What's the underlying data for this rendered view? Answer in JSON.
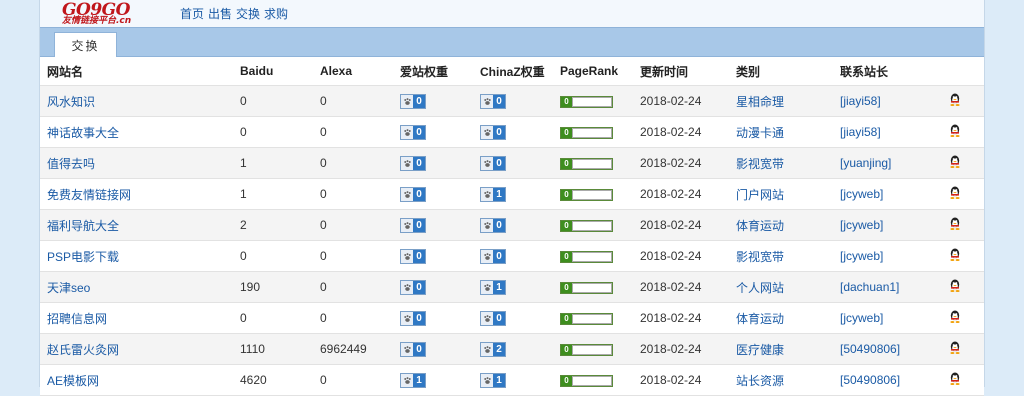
{
  "logo": {
    "brand": "GO9GO",
    "sub": "友情链接平台.cn"
  },
  "nav": [
    "首页",
    "出售",
    "交换",
    "求购"
  ],
  "tab": "交换",
  "columns": [
    "网站名",
    "Baidu",
    "Alexa",
    "爱站权重",
    "ChinaZ权重",
    "PageRank",
    "更新时间",
    "类别",
    "联系站长"
  ],
  "rows": [
    {
      "name": "风水知识",
      "baidu": "0",
      "alexa": "0",
      "aizhan": "0",
      "chinaz": "0",
      "pr": "0",
      "date": "2018-02-24",
      "cat": "星相命理",
      "contact": "[jiayi58]"
    },
    {
      "name": "神话故事大全",
      "baidu": "0",
      "alexa": "0",
      "aizhan": "0",
      "chinaz": "0",
      "pr": "0",
      "date": "2018-02-24",
      "cat": "动漫卡通",
      "contact": "[jiayi58]"
    },
    {
      "name": "值得去吗",
      "baidu": "1",
      "alexa": "0",
      "aizhan": "0",
      "chinaz": "0",
      "pr": "0",
      "date": "2018-02-24",
      "cat": "影视宽带",
      "contact": "[yuanjing]"
    },
    {
      "name": "免费友情链接网",
      "baidu": "1",
      "alexa": "0",
      "aizhan": "0",
      "chinaz": "1",
      "pr": "0",
      "date": "2018-02-24",
      "cat": "门户网站",
      "contact": "[jcyweb]"
    },
    {
      "name": "福利导航大全",
      "baidu": "2",
      "alexa": "0",
      "aizhan": "0",
      "chinaz": "0",
      "pr": "0",
      "date": "2018-02-24",
      "cat": "体育运动",
      "contact": "[jcyweb]"
    },
    {
      "name": "PSP电影下载",
      "baidu": "0",
      "alexa": "0",
      "aizhan": "0",
      "chinaz": "0",
      "pr": "0",
      "date": "2018-02-24",
      "cat": "影视宽带",
      "contact": "[jcyweb]"
    },
    {
      "name": "天津seo",
      "baidu": "190",
      "alexa": "0",
      "aizhan": "0",
      "chinaz": "1",
      "pr": "0",
      "date": "2018-02-24",
      "cat": "个人网站",
      "contact": "[dachuan1]"
    },
    {
      "name": "招聘信息网",
      "baidu": "0",
      "alexa": "0",
      "aizhan": "0",
      "chinaz": "0",
      "pr": "0",
      "date": "2018-02-24",
      "cat": "体育运动",
      "contact": "[jcyweb]"
    },
    {
      "name": "赵氏雷火灸网",
      "baidu": "1110",
      "alexa": "6962449",
      "aizhan": "0",
      "chinaz": "2",
      "pr": "0",
      "date": "2018-02-24",
      "cat": "医疗健康",
      "contact": "[50490806]"
    },
    {
      "name": "AE模板网",
      "baidu": "4620",
      "alexa": "0",
      "aizhan": "1",
      "chinaz": "1",
      "pr": "0",
      "date": "2018-02-24",
      "cat": "站长资源",
      "contact": "[50490806]"
    }
  ],
  "colors": {
    "link": "#1a5aa5",
    "tabbar": "#a8c8e8",
    "badge": "#2f78c4",
    "pr": "#3e8e1e",
    "logo": "#c0161b"
  },
  "icons": {
    "weight": "paw-icon",
    "contact": "qq-penguin-icon"
  }
}
